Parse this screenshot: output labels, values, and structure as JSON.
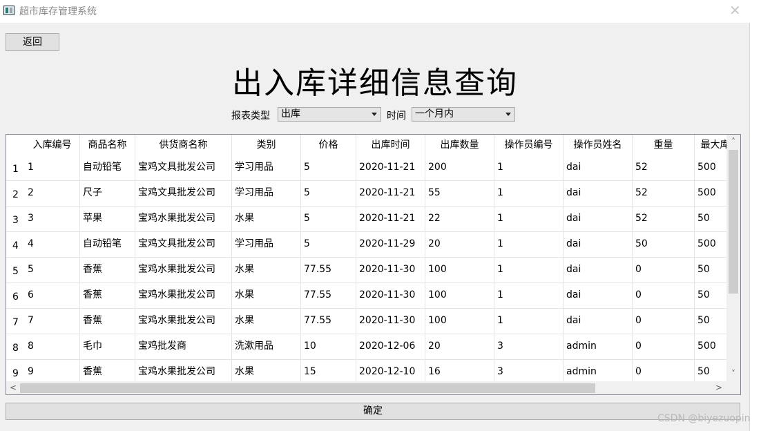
{
  "window": {
    "title": "超市库存管理系统",
    "close_glyph": "✕"
  },
  "toolbar": {
    "back_label": "返回"
  },
  "page": {
    "title": "出入库详细信息查询"
  },
  "filters": {
    "report_type_label": "报表类型",
    "report_type_value": "出库",
    "time_label": "时间",
    "time_value": "一个月内"
  },
  "table": {
    "columns": [
      "入库编号",
      "商品名称",
      "供货商名称",
      "类别",
      "价格",
      "出库时间",
      "出库数量",
      "操作员编号",
      "操作员姓名",
      "重量",
      "最大库"
    ],
    "row_numbers": [
      "1",
      "2",
      "3",
      "4",
      "5",
      "6",
      "7",
      "8",
      "9"
    ],
    "rows": [
      [
        "1",
        "自动铅笔",
        "宝鸡文具批发公司",
        "学习用品",
        "5",
        "2020-11-21",
        "200",
        "1",
        "dai",
        "52",
        "500"
      ],
      [
        "2",
        "尺子",
        "宝鸡文具批发公司",
        "学习用品",
        "5",
        "2020-11-21",
        "55",
        "1",
        "dai",
        "52",
        "500"
      ],
      [
        "3",
        "苹果",
        "宝鸡水果批发公司",
        "水果",
        "5",
        "2020-11-21",
        "22",
        "1",
        "dai",
        "52",
        "50"
      ],
      [
        "4",
        "自动铅笔",
        "宝鸡文具批发公司",
        "学习用品",
        "5",
        "2020-11-29",
        "20",
        "1",
        "dai",
        "50",
        "500"
      ],
      [
        "5",
        "香蕉",
        "宝鸡水果批发公司",
        "水果",
        "77.55",
        "2020-11-30",
        "100",
        "1",
        "dai",
        "0",
        "50"
      ],
      [
        "6",
        "香蕉",
        "宝鸡水果批发公司",
        "水果",
        "77.55",
        "2020-11-30",
        "100",
        "1",
        "dai",
        "0",
        "50"
      ],
      [
        "7",
        "香蕉",
        "宝鸡水果批发公司",
        "水果",
        "77.55",
        "2020-11-30",
        "100",
        "1",
        "dai",
        "0",
        "50"
      ],
      [
        "8",
        "毛巾",
        "宝鸡批发商",
        "洗漱用品",
        "10",
        "2020-12-06",
        "20",
        "3",
        "admin",
        "0",
        "500"
      ],
      [
        "9",
        "香蕉",
        "宝鸡水果批发公司",
        "水果",
        "15",
        "2020-12-10",
        "16",
        "3",
        "admin",
        "0",
        "50"
      ]
    ]
  },
  "footer": {
    "ok_label": "确定"
  },
  "watermark": "CSDN @biyezuopin",
  "icons": {
    "scroll_up": "˄",
    "scroll_down": "˅",
    "scroll_left": "<",
    "scroll_right": ">"
  }
}
